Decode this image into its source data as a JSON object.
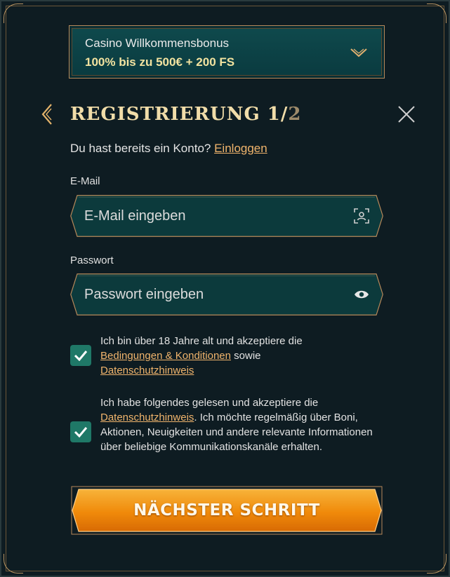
{
  "bonus": {
    "title": "Casino Willkommensbonus",
    "value": "100% bis zu 500€ + 200 FS",
    "icon": "chevron-down-icon"
  },
  "header": {
    "title": "REGISTRIERUNG 1/",
    "title_step_total": "2",
    "back_icon": "chevron-left-icon",
    "close_icon": "close-icon"
  },
  "login": {
    "prompt": "Du hast bereits ein Konto?",
    "link": "Einloggen"
  },
  "form": {
    "email": {
      "label": "E-Mail",
      "placeholder": "E-Mail eingeben",
      "value": "",
      "icon": "face-scan-icon"
    },
    "password": {
      "label": "Passwort",
      "placeholder": "Passwort eingeben",
      "value": "",
      "icon": "eye-icon"
    }
  },
  "consents": [
    {
      "checked": true,
      "text1": "Ich bin über 18 Jahre alt und akzeptiere die",
      "link1": "Bedingungen & Konditionen",
      "text2": "sowie",
      "link2": "Datenschutzhinweis"
    },
    {
      "checked": true,
      "text1": "Ich habe folgendes gelesen und akzeptiere die",
      "link1": "Datenschutzhinweis",
      "text2": ". Ich möchte regelmäßig über Boni, Aktionen, Neuigkeiten und andere relevante Informationen über beliebige Kommunikationskanäle erhalten."
    }
  ],
  "next_button": {
    "label": "NÄCHSTER SCHRITT"
  },
  "colors": {
    "background": "#0e1c22",
    "gold": "#b8895a",
    "link": "#f0b46c",
    "checkbox": "#1f7867",
    "button": "#f0920f"
  }
}
